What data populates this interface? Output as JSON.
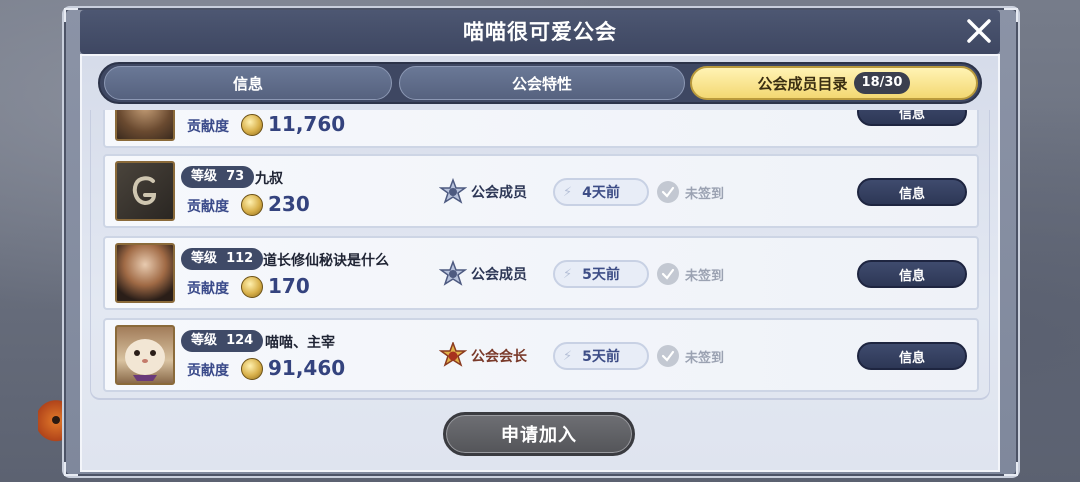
{
  "dialog": {
    "title": "喵喵很可爱公会"
  },
  "tabs": [
    {
      "label": "信息",
      "active": false
    },
    {
      "label": "公会特性",
      "active": false
    },
    {
      "label": "公会成员目录",
      "active": true,
      "count": "18/30"
    }
  ],
  "members": [
    {
      "partial": true,
      "contribution_label": "贡献度",
      "contribution": "11,760",
      "info_label": "信息"
    },
    {
      "level_label": "等级",
      "level": "73",
      "name": "九叔",
      "contribution_label": "贡献度",
      "contribution": "230",
      "role": "公会成员",
      "last_online": "4天前",
      "sign_status": "未签到",
      "info_label": "信息",
      "avatar": "letter-g-avatar"
    },
    {
      "level_label": "等级",
      "level": "112",
      "name": "道长修仙秘诀是什么",
      "contribution_label": "贡献度",
      "contribution": "170",
      "role": "公会成员",
      "last_online": "5天前",
      "sign_status": "未签到",
      "info_label": "信息",
      "avatar": "anime-girl-avatar"
    },
    {
      "level_label": "等级",
      "level": "124",
      "name": "喵喵、主宰",
      "contribution_label": "贡献度",
      "contribution": "91,460",
      "role": "公会会长",
      "last_online": "5天前",
      "sign_status": "未签到",
      "info_label": "信息",
      "avatar": "hamster-avatar"
    }
  ],
  "apply_button": "申请加入",
  "colors": {
    "title_bar": "#3e4762",
    "active_tab": "#f3d872",
    "info_button": "#2d3756",
    "contribution_text": "#34437e",
    "leader_role": "#7a3a2a",
    "member_role": "#2d3756"
  }
}
